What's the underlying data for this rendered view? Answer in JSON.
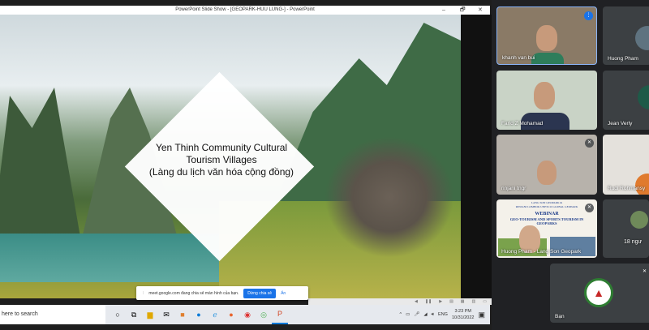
{
  "window": {
    "title": "PowerPoint Slide Show - [GEOPARK-HUU LUNG-] - PowerPoint",
    "minimize": "–",
    "restore": "🗗",
    "close": "✕"
  },
  "slide": {
    "title_lines": [
      "Yen Thinh Community Cultural",
      "Tourism Villages",
      "(Làng du lịch văn hóa cộng đồng)"
    ]
  },
  "share_banner": {
    "text": "meet.google.com đang chia sẻ màn hình của bạn.",
    "stop_label": "Dừng chia sẻ",
    "hide_label": "Ẩn"
  },
  "taskbar": {
    "search_placeholder": "here to search",
    "language": "ENG",
    "time": "3:23 PM",
    "date": "10/31/2022",
    "apps": [
      "cortana",
      "task-view",
      "file-explorer",
      "mail",
      "media",
      "edge",
      "ie",
      "firefox",
      "chrome",
      "coccoc",
      "powerpoint"
    ]
  },
  "participants": [
    {
      "name": "khanh van bui",
      "speaking": true
    },
    {
      "name": "Huong Pham"
    },
    {
      "name": "Farid Z Mohamad"
    },
    {
      "name": "Jean Verly"
    },
    {
      "name": "rinjani tngr",
      "muted": true
    },
    {
      "name": "Rudi Rohmansy"
    },
    {
      "name": "Huong Pham - Lang Son Geopark",
      "muted": true,
      "slide_lines": [
        "LANG SON GEOPARK &",
        "RINJANI LOMBOK UNESCO GLOBAL GEOPARK",
        "WEBINAR",
        "GEO-TOURISM AND SPORTS TOURISM IN",
        "GEOPARKS"
      ]
    },
    {
      "name": "18 ngư"
    },
    {
      "name": "Bạn",
      "muted": true
    }
  ],
  "colors": {
    "accent": "#1a73e8",
    "tile": "#3c4043",
    "background": "#202124"
  }
}
